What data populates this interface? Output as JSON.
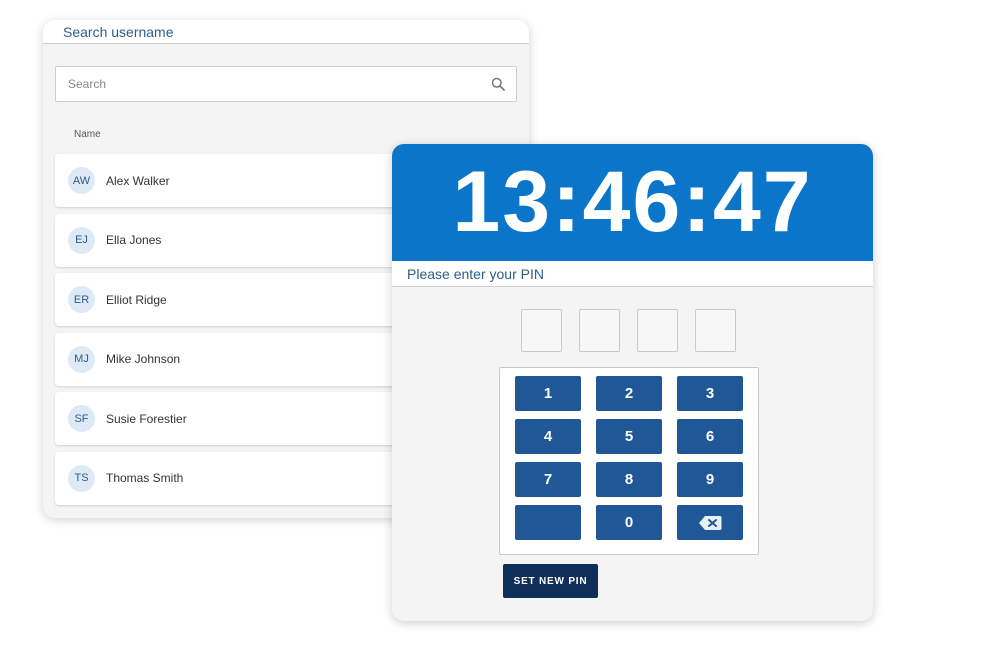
{
  "user_panel": {
    "title": "Search username",
    "search": {
      "placeholder": "Search",
      "value": ""
    },
    "column_header": "Name",
    "users": [
      {
        "initials": "AW",
        "name": "Alex Walker"
      },
      {
        "initials": "EJ",
        "name": "Ella Jones"
      },
      {
        "initials": "ER",
        "name": "Elliot Ridge"
      },
      {
        "initials": "MJ",
        "name": "Mike Johnson"
      },
      {
        "initials": "SF",
        "name": "Susie Forestier"
      },
      {
        "initials": "TS",
        "name": "Thomas Smith"
      }
    ]
  },
  "pin_panel": {
    "clock": "13:46:47",
    "prompt": "Please enter your PIN",
    "slot_count": 4,
    "keys": [
      "1",
      "2",
      "3",
      "4",
      "5",
      "6",
      "7",
      "8",
      "9",
      "",
      "0",
      "backspace-icon"
    ],
    "set_new_pin_label": "SET NEW PIN"
  },
  "colors": {
    "clock_bar": "#0b76c9",
    "key": "#1f5797",
    "set_pin_button": "#0e2f5a",
    "header_text": "#2e5d86",
    "avatar_bg": "#dde9f5"
  }
}
